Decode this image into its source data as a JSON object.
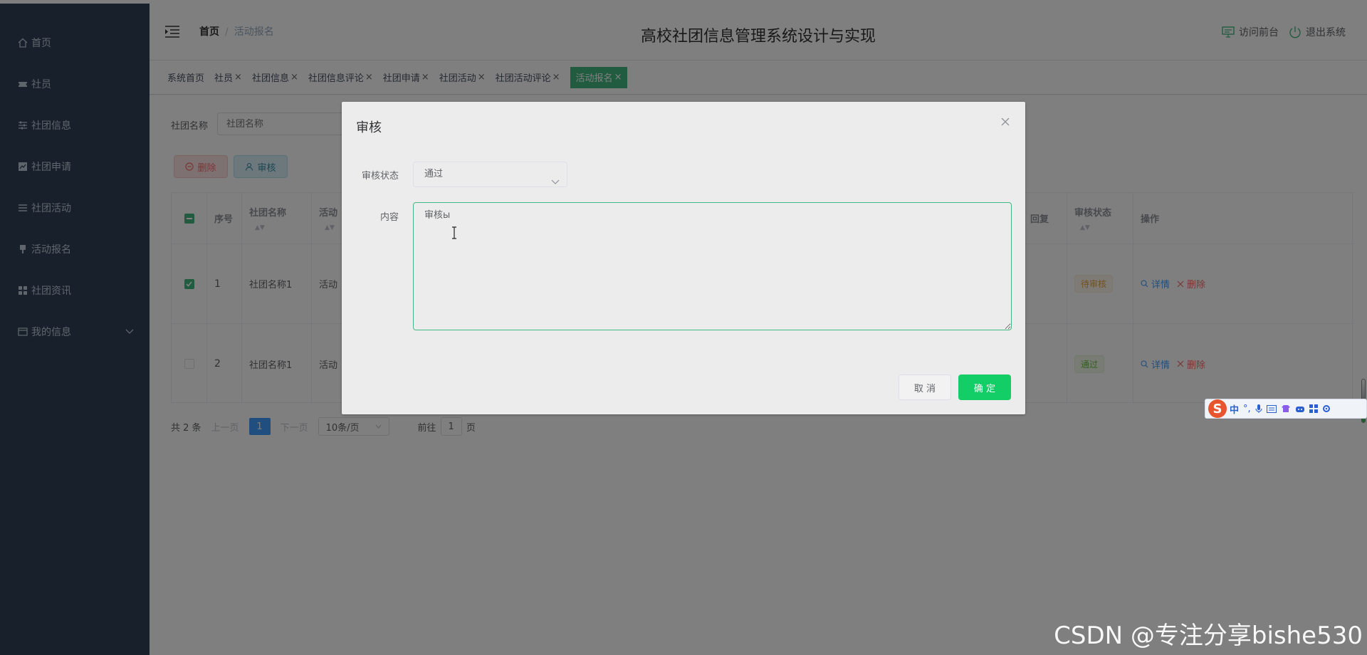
{
  "app": {
    "caption": "高校社团信息管理系统设计与实现"
  },
  "sidebar": {
    "items": [
      {
        "label": "首页",
        "icon": "home-icon"
      },
      {
        "label": "社员",
        "icon": "ticket-icon"
      },
      {
        "label": "社团信息",
        "icon": "sliders-icon"
      },
      {
        "label": "社团申请",
        "icon": "chart-icon"
      },
      {
        "label": "社团活动",
        "icon": "list-icon"
      },
      {
        "label": "活动报名",
        "icon": "pin-icon"
      },
      {
        "label": "社团资讯",
        "icon": "grid-icon"
      },
      {
        "label": "我的信息",
        "icon": "wallet-icon"
      }
    ]
  },
  "header": {
    "breadcrumb_home": "首页",
    "breadcrumb_separator": "/",
    "breadcrumb_current": "活动报名",
    "visit_front": "访问前台",
    "logout": "退出系统"
  },
  "tags": [
    {
      "label": "系统首页",
      "closable": false
    },
    {
      "label": "社员",
      "closable": true
    },
    {
      "label": "社团信息",
      "closable": true
    },
    {
      "label": "社团信息评论",
      "closable": true
    },
    {
      "label": "社团申请",
      "closable": true
    },
    {
      "label": "社团活动",
      "closable": true
    },
    {
      "label": "社团活动评论",
      "closable": true
    },
    {
      "label": "活动报名",
      "closable": true,
      "active": true
    }
  ],
  "search": {
    "label": "社团名称",
    "placeholder": "社团名称"
  },
  "actions": {
    "delete": "删除",
    "audit": "审核"
  },
  "table": {
    "headers": {
      "index": "序号",
      "club_name": "社团名称",
      "activity": "活动",
      "reply": "回复",
      "audit_status": "审核状态",
      "ops": "操作"
    },
    "rows": [
      {
        "checked": true,
        "index": "1",
        "club_name": "社团名称1",
        "activity": "活动",
        "status": "待审核",
        "status_type": "wait"
      },
      {
        "checked": false,
        "index": "2",
        "club_name": "社团名称1",
        "activity": "活动",
        "status": "通过",
        "status_type": "ok"
      }
    ],
    "detail_label": "详情",
    "delete_label": "删除"
  },
  "pagination": {
    "total": "共 2 条",
    "prev": "上一页",
    "current_page": "1",
    "next": "下一页",
    "page_size": "10条/页",
    "goto_prefix": "前往",
    "goto_value": "1",
    "goto_suffix": "页"
  },
  "dialog": {
    "title": "审核",
    "status_label": "审核状态",
    "status_value": "通过",
    "content_label": "内容",
    "content_value": "审核ы",
    "cancel": "取 消",
    "confirm": "确 定"
  },
  "ime": {
    "logo": "S",
    "mode": "中",
    "punct": "°,"
  },
  "watermark": "CSDN @专注分享bishe530",
  "colors": {
    "sidebar_bg": "#304156",
    "accent": "#42b983",
    "confirm": "#13ce66",
    "danger": "#f56c6c",
    "link": "#409eff"
  }
}
